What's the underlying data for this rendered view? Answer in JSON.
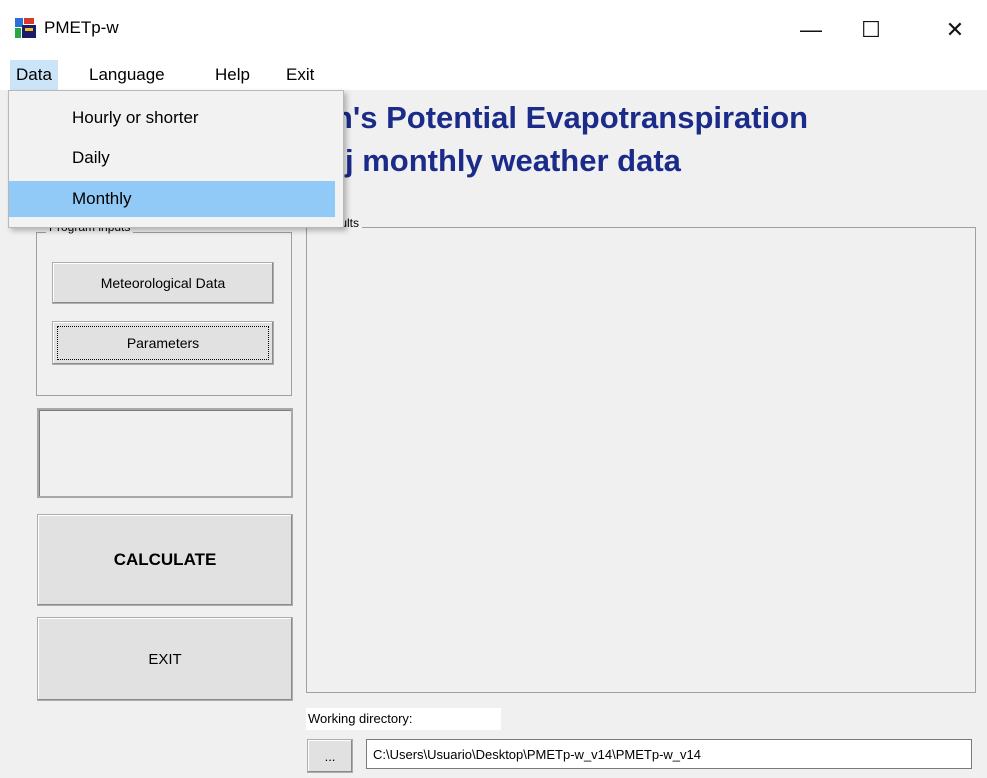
{
  "window": {
    "title": "PMETp-w",
    "controls": {
      "minimize": "—",
      "maximize": "☐",
      "close": "✕"
    }
  },
  "menubar": {
    "items": [
      {
        "label": "Data"
      },
      {
        "label": "Language"
      },
      {
        "label": "Help"
      },
      {
        "label": "Exit"
      }
    ]
  },
  "dropdown": {
    "items": [
      {
        "label": "Hourly or shorter"
      },
      {
        "label": "Daily"
      },
      {
        "label": "Monthly",
        "highlighted": true
      }
    ]
  },
  "heading": {
    "line1": "ith's Potential Evapotranspiration",
    "line2": "j monthly weather data"
  },
  "program_inputs": {
    "legend": "Program inputs",
    "meteo_button": "Meteorological Data",
    "params_button": "Parameters"
  },
  "actions": {
    "calculate": "CALCULATE",
    "exit": "EXIT"
  },
  "results": {
    "legend": "Results"
  },
  "working_directory": {
    "label": "Working directory:",
    "browse": "...",
    "path": "C:\\Users\\Usuario\\Desktop\\PMETp-w_v14\\PMETp-w_v14"
  },
  "colors": {
    "heading": "#1a2b8a",
    "menu_highlight": "#91c9f7",
    "menubar_active": "#cce4f7",
    "background": "#f0f0f0"
  },
  "icons": {
    "app": "pmetp-app-icon"
  }
}
